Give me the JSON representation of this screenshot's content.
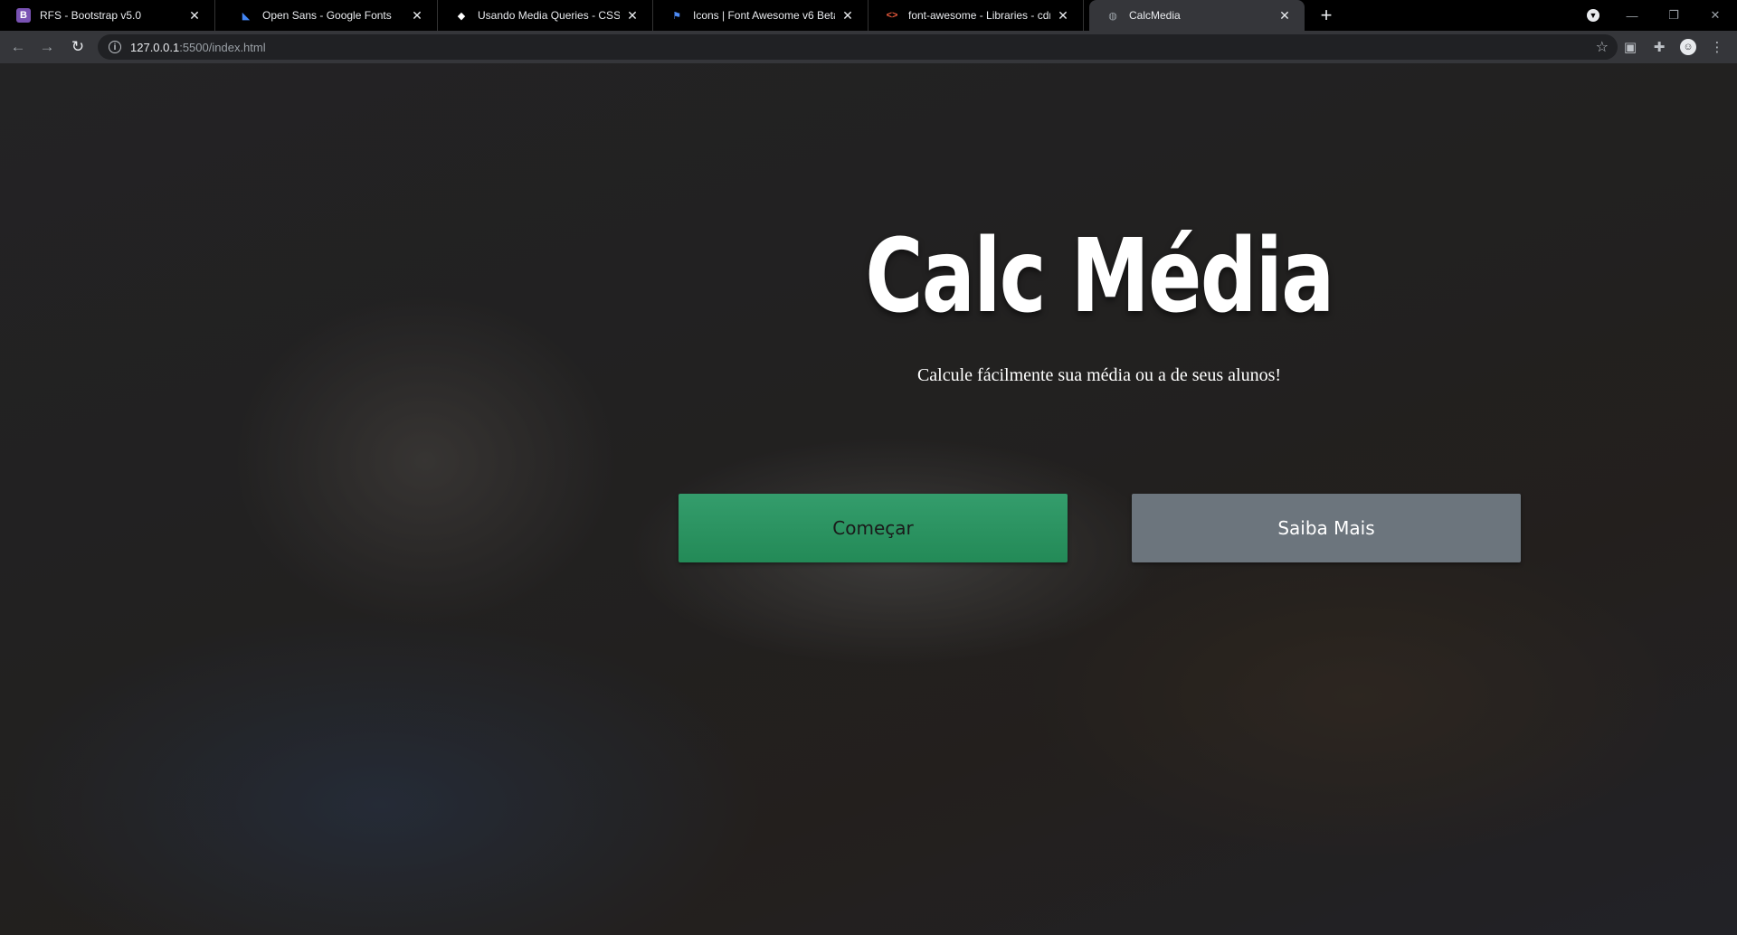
{
  "browser": {
    "tabs": [
      {
        "title": "RFS - Bootstrap v5.0",
        "favicon": "bootstrap-icon",
        "favicon_color": "#7952b3"
      },
      {
        "title": "Open Sans - Google Fonts",
        "favicon": "google-fonts-icon",
        "favicon_color": "#4285f4"
      },
      {
        "title": "Usando Media Queries - CSS | MDN",
        "favicon": "mdn-icon",
        "favicon_color": "#ffffff"
      },
      {
        "title": "Icons | Font Awesome v6 Beta",
        "favicon": "flag-icon",
        "favicon_color": "#4d8bf5"
      },
      {
        "title": "font-awesome - Libraries - cdnjs",
        "favicon": "code-icon",
        "favicon_color": "#e8593c"
      },
      {
        "title": "CalcMedia",
        "favicon": "globe-icon",
        "favicon_color": "#9aa0a6"
      }
    ],
    "active_tab": 5,
    "address": {
      "host": "127.0.0.1",
      "path": ":5500/index.html"
    }
  },
  "hero": {
    "title": "Calc Média",
    "subtitle": "Calcule fácilmente sua média ou a de seus alunos!"
  },
  "buttons": {
    "start": "Começar",
    "learn_more": "Saiba Mais"
  },
  "colors": {
    "primary": "#2e9563",
    "secondary": "#6c757d",
    "title_text": "#ffffff"
  }
}
